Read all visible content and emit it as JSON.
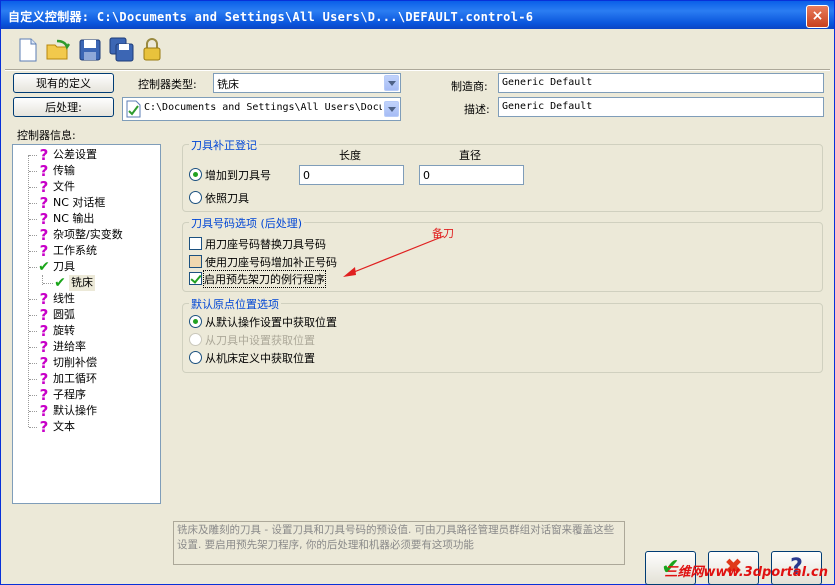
{
  "window": {
    "title": "自定义控制器: C:\\Documents and Settings\\All Users\\D...\\DEFAULT.control-6",
    "close_glyph": "×"
  },
  "toolbar": [
    "new-file-icon",
    "open-folder-icon",
    "save-icon",
    "save-all-icon",
    "lock-icon"
  ],
  "header": {
    "existing_definitions_button": "现有的定义",
    "postprocess_button": "后处理:",
    "controller_type_label": "控制器类型:",
    "controller_type_value": "铣床",
    "post_path_value": "C:\\Documents and Settings\\All Users\\Docu",
    "manufacturer_label": "制造商:",
    "manufacturer_value": "Generic Default",
    "description_label": "描述:",
    "description_value": "Generic Default"
  },
  "tree": {
    "label": "控制器信息:",
    "items": [
      {
        "label": "公差设置",
        "icon": "question-icon"
      },
      {
        "label": "传输",
        "icon": "question-icon"
      },
      {
        "label": "文件",
        "icon": "question-icon"
      },
      {
        "label": "NC 对话框",
        "icon": "question-icon"
      },
      {
        "label": "NC 输出",
        "icon": "question-icon"
      },
      {
        "label": "杂项整/实变数",
        "icon": "question-icon"
      },
      {
        "label": "工作系统",
        "icon": "question-icon"
      },
      {
        "label": "刀具",
        "icon": "check-icon"
      },
      {
        "label": "铣床",
        "icon": "check-icon",
        "selected": true
      },
      {
        "label": "线性",
        "icon": "question-icon"
      },
      {
        "label": "圆弧",
        "icon": "question-icon"
      },
      {
        "label": "旋转",
        "icon": "question-icon"
      },
      {
        "label": "进给率",
        "icon": "question-icon"
      },
      {
        "label": "切削补偿",
        "icon": "question-icon"
      },
      {
        "label": "加工循环",
        "icon": "question-icon"
      },
      {
        "label": "子程序",
        "icon": "question-icon"
      },
      {
        "label": "默认操作",
        "icon": "question-icon"
      },
      {
        "label": "文本",
        "icon": "question-icon"
      }
    ]
  },
  "tool_offset": {
    "title": "刀具补正登记",
    "length_label": "长度",
    "diameter_label": "直径",
    "add_to_tool_label": "增加到刀具号",
    "per_tool_label": "依照刀具",
    "length_value": "0",
    "diameter_value": "0",
    "selected": "add_to_tool"
  },
  "tool_number": {
    "title": "刀具号码选项 (后处理)",
    "options": [
      {
        "label": "用刀座号码替换刀具号码",
        "checked": false
      },
      {
        "label": "使用刀座号码增加补正号码",
        "checked": false
      },
      {
        "label": "启用预先架刀的例行程序",
        "checked": true
      }
    ]
  },
  "origin": {
    "title": "默认原点位置选项",
    "options": [
      {
        "label": "从默认操作设置中获取位置",
        "selected": true,
        "disabled": false
      },
      {
        "label": "从刀具中设置获取位置",
        "selected": false,
        "disabled": true
      },
      {
        "label": "从机床定义中获取位置",
        "selected": false,
        "disabled": false
      }
    ]
  },
  "description_text": "铣床及雕刻的刀具 - 设置刀具和刀具号码的预设值. 可由刀具路径管理员群组对话窗来覆盖这些设置. 要启用预先架刀程序, 你的后处理和机器必须要有这项功能",
  "annotation": "备刀",
  "buttons": {
    "ok_glyph": "✔",
    "cancel_glyph": "✖",
    "help_glyph": "?"
  },
  "watermark": "三维网www.3dportal.cn",
  "colors": {
    "title_bar": "#0a5fe8",
    "group_title": "#0046d5",
    "question_icon": "#c800c8",
    "check_icon": "#1aa51a",
    "annotation": "#e02020"
  }
}
